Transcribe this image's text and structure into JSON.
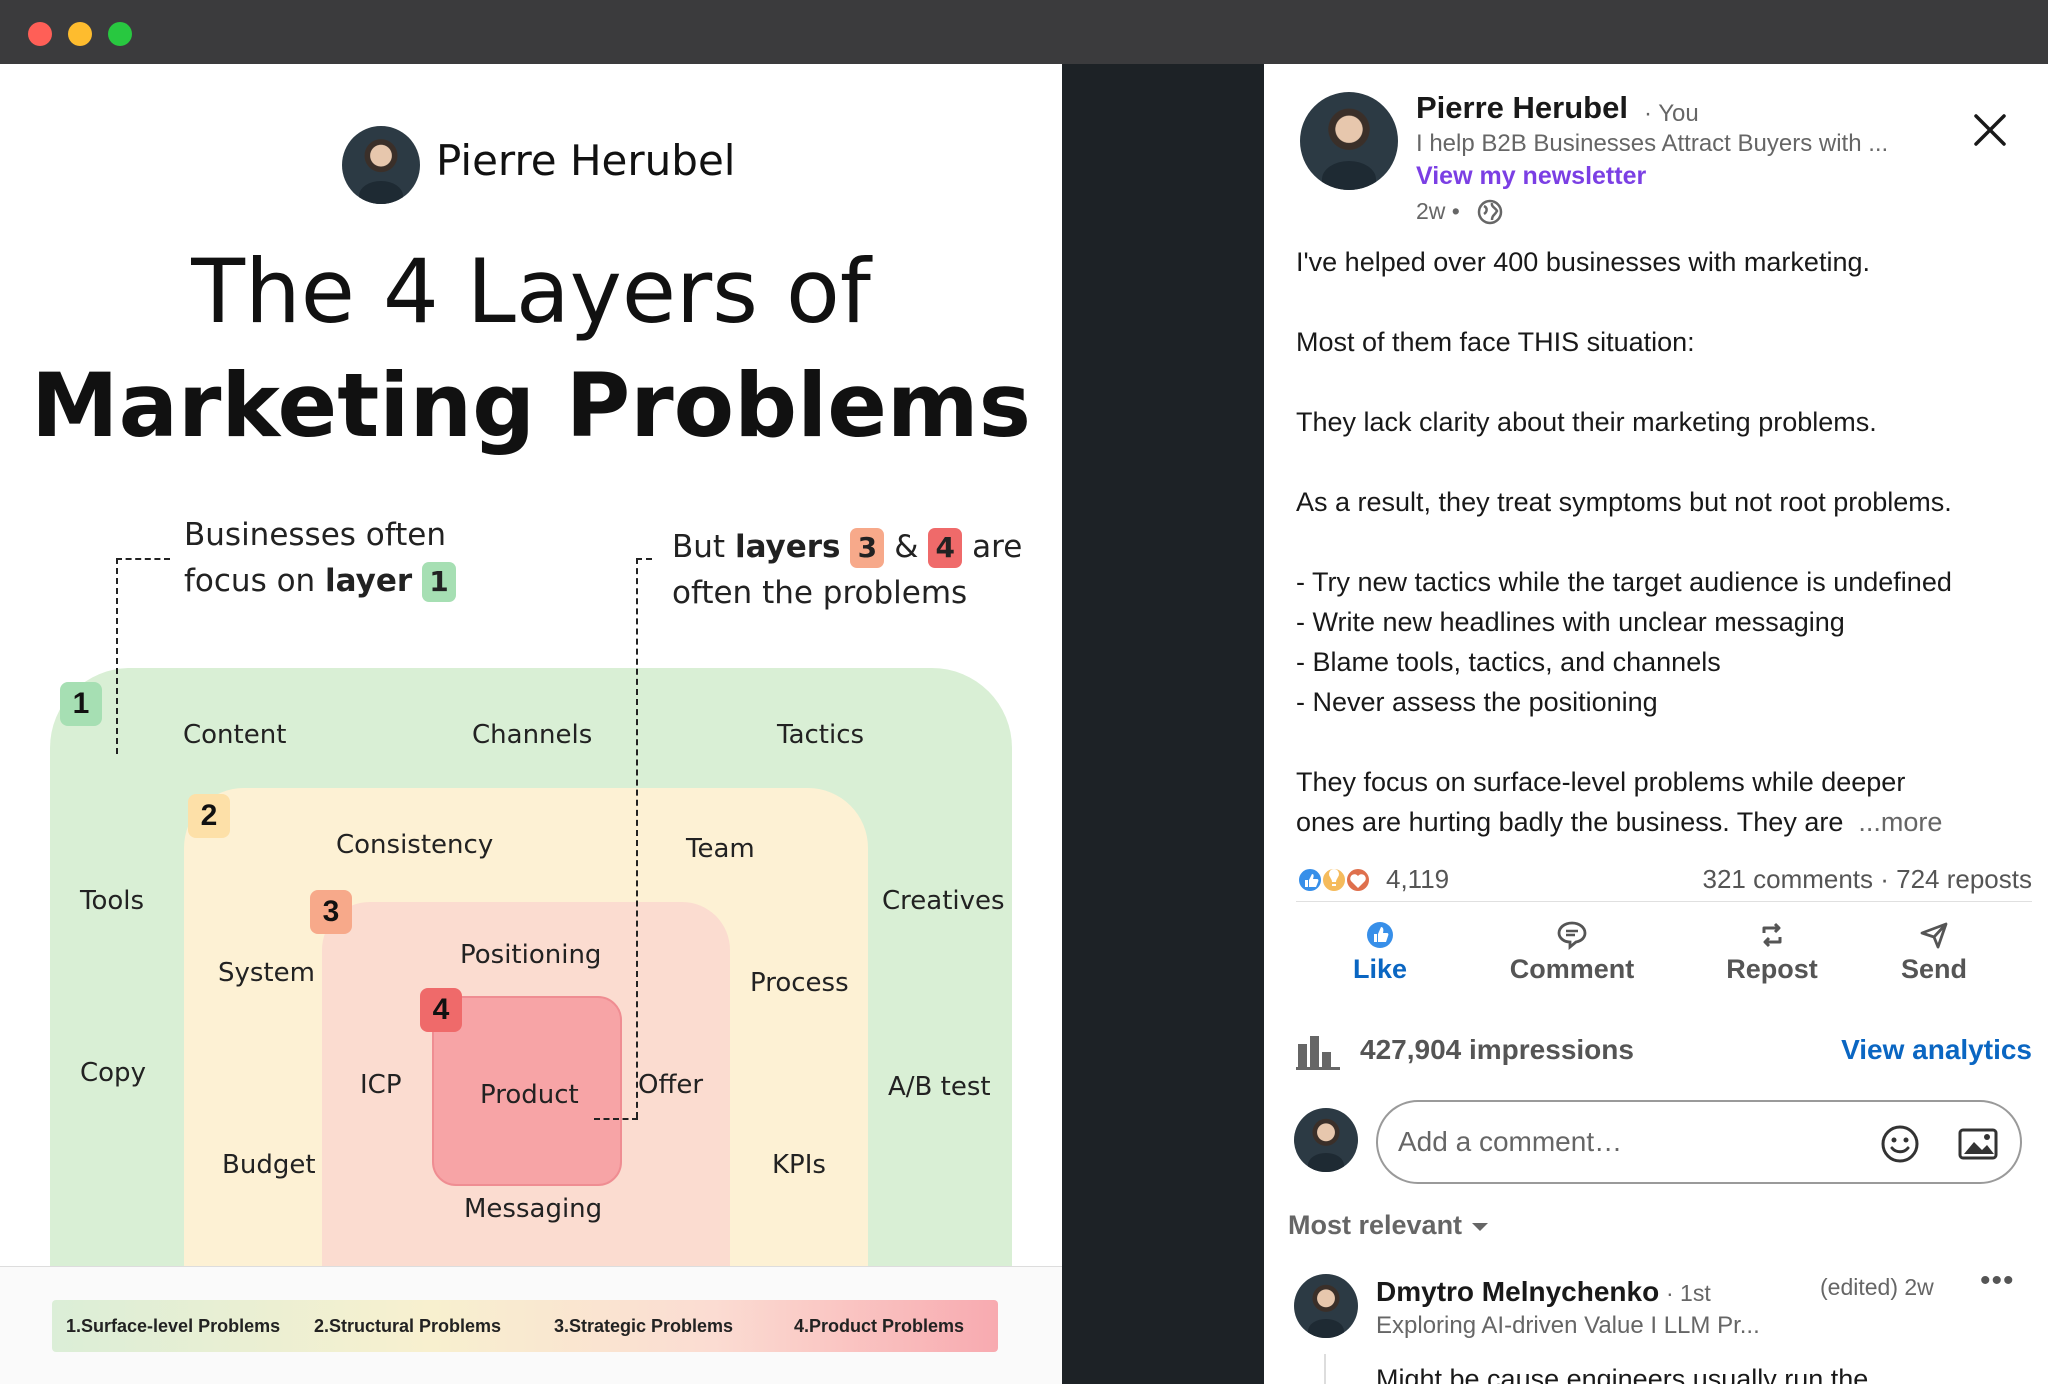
{
  "window": {
    "controls": [
      "close",
      "minimize",
      "zoom"
    ]
  },
  "infographic": {
    "author": "Pierre Herubel",
    "title_line1": "The 4 Layers of",
    "title_line2": "Marketing Problems",
    "callout_left": {
      "line1": "Businesses often",
      "line2_prefix": "focus on ",
      "line2_bold": "layer",
      "badge": "1"
    },
    "callout_right": {
      "prefix": "But ",
      "bold": "layers",
      "badge_a": "3",
      "amp": "&",
      "badge_b": "4",
      "suffix": "are",
      "line2": "often the problems"
    },
    "layers": {
      "l1": {
        "number": "1",
        "labels": [
          "Content",
          "Channels",
          "Tactics",
          "Tools",
          "Creatives",
          "Copy",
          "A/B test"
        ]
      },
      "l2": {
        "number": "2",
        "labels": [
          "Consistency",
          "Team",
          "System",
          "Process",
          "Budget",
          "KPIs"
        ]
      },
      "l3": {
        "number": "3",
        "labels": [
          "Positioning",
          "ICP",
          "Offer",
          "Messaging"
        ]
      },
      "l4": {
        "number": "4",
        "labels": [
          "Product"
        ]
      }
    },
    "legend": [
      "1.Surface-level Problems",
      "2.Structural Problems",
      "3.Strategic Problems",
      "4.Product Problems"
    ]
  },
  "post": {
    "author_name": "Pierre Herubel",
    "author_you": "· You",
    "author_headline": "I help B2B Businesses Attract Buyers with ...",
    "newsletter_link": "View my newsletter",
    "age": "2w •",
    "body": [
      "I've helped over 400 businesses with marketing.",
      "",
      "Most of them face THIS situation:",
      "",
      "They lack clarity about their marketing problems.",
      "",
      "As a result, they treat symptoms but not root problems.",
      "",
      "- Try new tactics while the target audience is undefined",
      "- Write new headlines with unclear messaging",
      "- Blame tools, tactics, and channels",
      "- Never assess the positioning",
      "",
      "They focus on surface-level problems while deeper",
      "ones are hurting badly the business. They are"
    ],
    "more_link": "...more",
    "reaction_count": "4,119",
    "comments_reposts": "321 comments · 724 reposts",
    "actions": {
      "like": "Like",
      "comment": "Comment",
      "repost": "Repost",
      "send": "Send"
    },
    "impressions": "427,904 impressions",
    "analytics_link": "View analytics",
    "comment_placeholder": "Add a comment…",
    "sort_label": "Most relevant",
    "top_comment": {
      "name": "Dmytro Melnychenko",
      "degree": "· 1st",
      "time": "(edited) 2w",
      "menu": "•••",
      "headline": "Exploring AI-driven Value I LLM Pr...",
      "snippet": "Might be cause engineers usually run the"
    }
  },
  "colors": {
    "layer1": "#d9efd5",
    "layer2": "#fdf1d4",
    "layer3": "#fbdcd0",
    "layer4": "#f7a4a6",
    "linkedin_blue": "#0a66c2",
    "newsletter_purple": "#7b3fe4"
  }
}
